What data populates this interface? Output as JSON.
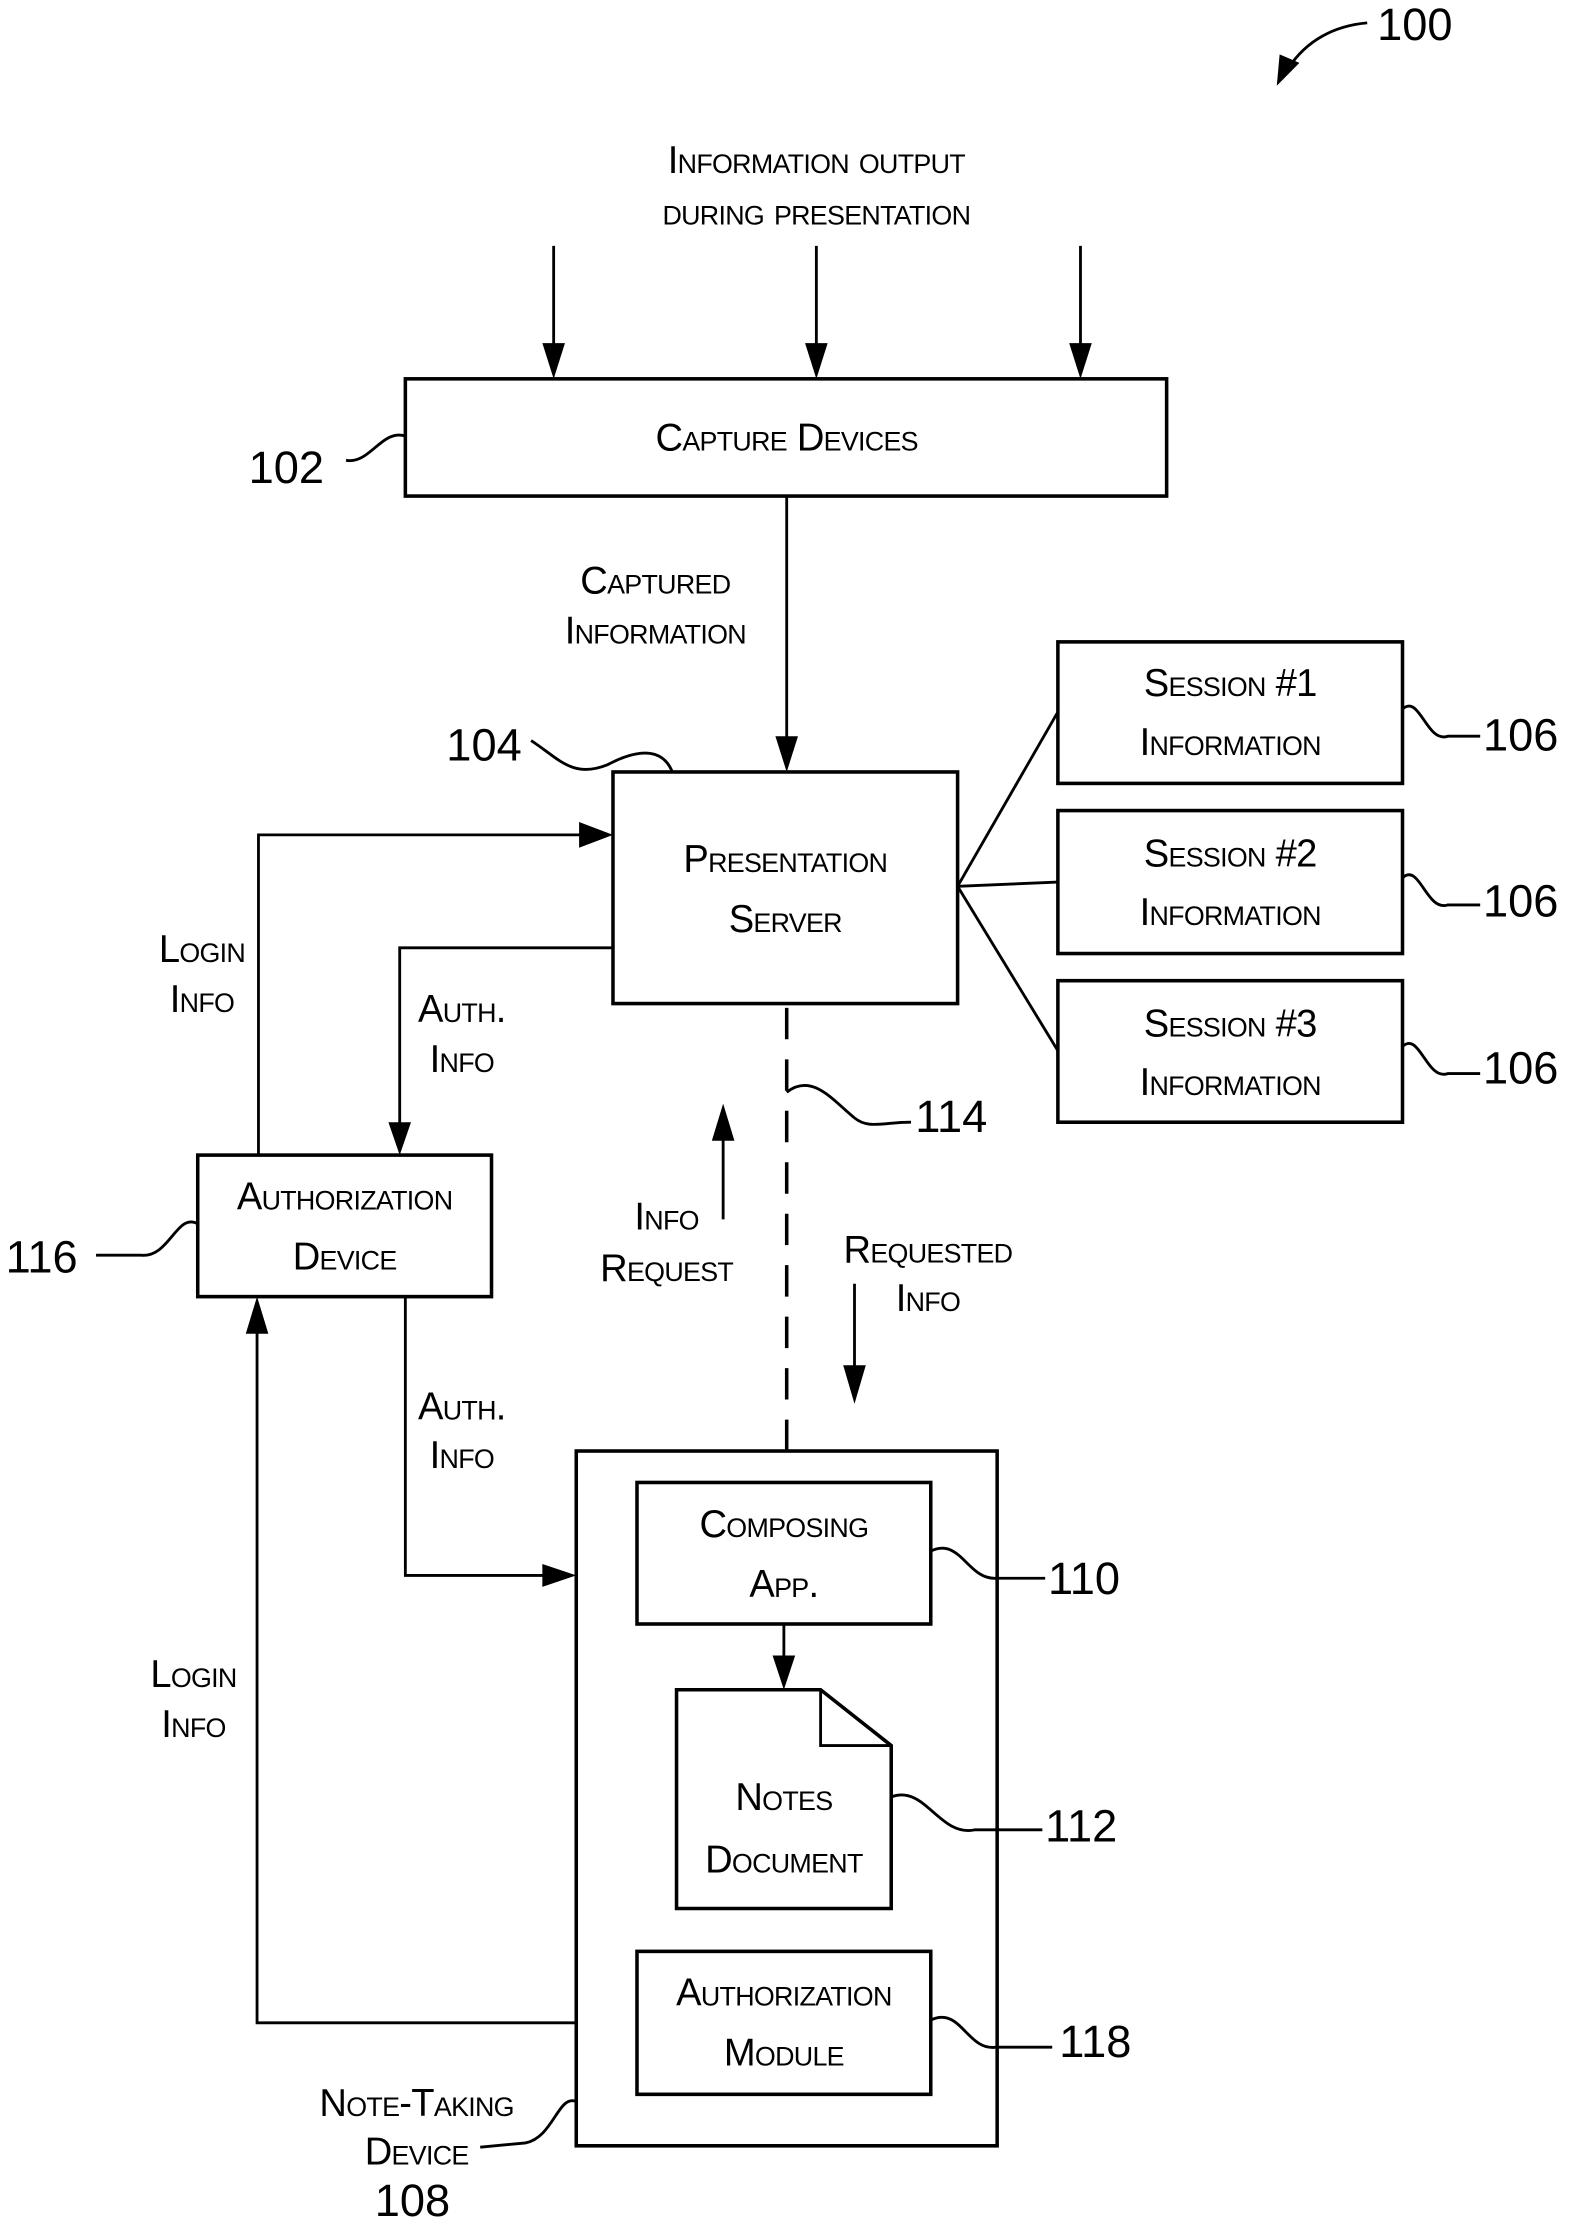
{
  "figure_ref": "100",
  "input_label": {
    "line1": "Information output",
    "line2": "during  presentation"
  },
  "capture_devices": {
    "label": "Capture Devices",
    "ref": "102"
  },
  "captured_info": {
    "line1": "Captured",
    "line2": "Information"
  },
  "presentation_server": {
    "line1": "Presentation",
    "line2": "Server",
    "ref": "104"
  },
  "sessions": [
    {
      "line1": "Session #1",
      "line2": "Information",
      "ref": "106"
    },
    {
      "line1": "Session #2",
      "line2": "Information",
      "ref": "106"
    },
    {
      "line1": "Session #3",
      "line2": "Information",
      "ref": "106"
    }
  ],
  "login_info_top": {
    "line1": "Login",
    "line2": "Info"
  },
  "auth_info_top": {
    "line1": "Auth.",
    "line2": "Info"
  },
  "authorization_device": {
    "line1": "Authorization",
    "line2": "Device",
    "ref": "116"
  },
  "network": {
    "ref": "114"
  },
  "info_request": {
    "line1": "Info",
    "line2": "Request"
  },
  "requested_info": {
    "line1": "Requested",
    "line2": "Info"
  },
  "auth_info_bottom": {
    "line1": "Auth.",
    "line2": "Info"
  },
  "login_info_bottom": {
    "line1": "Login",
    "line2": "Info"
  },
  "composing_app": {
    "line1": "Composing",
    "line2": "App.",
    "ref": "110"
  },
  "notes_document": {
    "line1": "Notes",
    "line2": "Document",
    "ref": "112"
  },
  "authorization_module": {
    "line1": "Authorization",
    "line2": "Module",
    "ref": "118"
  },
  "note_taking_device": {
    "line1": "Note-Taking",
    "line2": "Device",
    "ref": "108"
  }
}
